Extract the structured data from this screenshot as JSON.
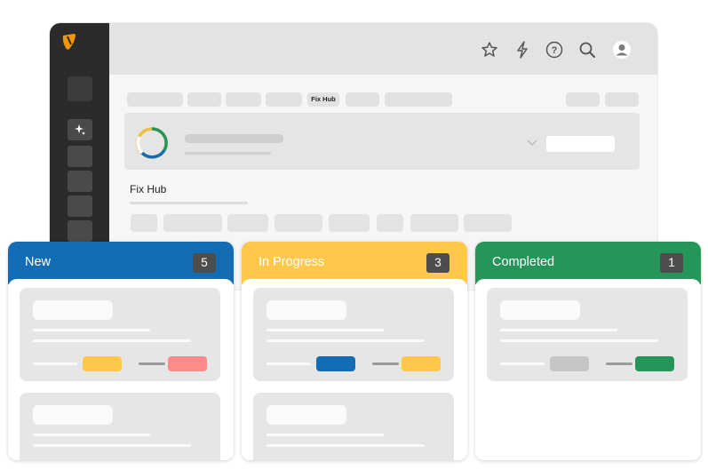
{
  "breadcrumb": {
    "active_label": "Fix Hub"
  },
  "page": {
    "title": "Fix Hub"
  },
  "sidebar": {
    "active_icon": "sparkle-icon"
  },
  "topbar": {
    "icons": [
      "star-icon",
      "bolt-icon",
      "help-icon",
      "search-icon",
      "user-avatar-icon"
    ]
  },
  "colors": {
    "new": "#146cb4",
    "in_progress": "#ffc84a",
    "completed": "#26955a",
    "red_tag": "#ff8a8a",
    "gray_tag": "#c6c6c6",
    "typo3": "#f49700"
  },
  "board": {
    "columns": [
      {
        "title": "New",
        "count": "5"
      },
      {
        "title": "In Progress",
        "count": "3"
      },
      {
        "title": "Completed",
        "count": "1"
      }
    ]
  }
}
